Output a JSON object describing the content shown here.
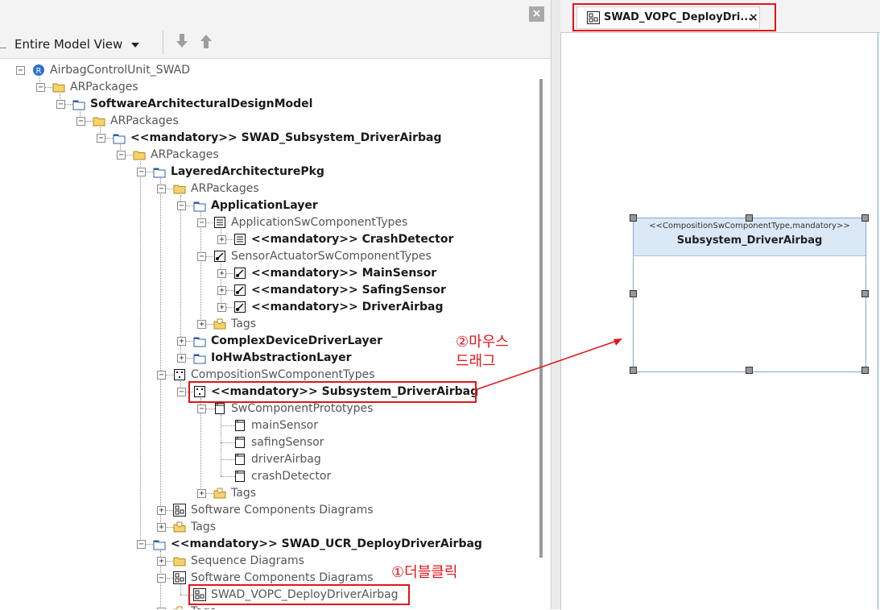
{
  "explorer": {
    "close_label": "×",
    "view_select": {
      "value": "Entire Model View"
    },
    "move_down_tooltip_icon": "arrow-down-icon",
    "move_up_tooltip_icon": "arrow-up-icon",
    "tree": [
      {
        "label": "AirbagControlUnit_SWAD",
        "icon": "model-icon",
        "bold": false,
        "indent": 0
      },
      {
        "label": "ARPackages",
        "icon": "folder-icon",
        "bold": false,
        "indent": 1
      },
      {
        "label": "SoftwareArchitecturalDesignModel",
        "icon": "package-icon",
        "bold": true,
        "indent": 2
      },
      {
        "label": "ARPackages",
        "icon": "folder-icon",
        "bold": false,
        "indent": 3
      },
      {
        "label": "<<mandatory>> SWAD_Subsystem_DriverAirbag",
        "icon": "package-icon",
        "bold": true,
        "indent": 4
      },
      {
        "label": "ARPackages",
        "icon": "folder-icon",
        "bold": false,
        "indent": 5
      },
      {
        "label": "LayeredArchitecturePkg",
        "icon": "package-icon",
        "bold": true,
        "indent": 6
      },
      {
        "label": "ARPackages",
        "icon": "folder-icon",
        "bold": false,
        "indent": 7
      },
      {
        "label": "ApplicationLayer",
        "icon": "package-icon",
        "bold": true,
        "indent": 8
      },
      {
        "label": "ApplicationSwComponentTypes",
        "icon": "application-component-icon",
        "bold": false,
        "indent": 9
      },
      {
        "label": "<<mandatory>> CrashDetector",
        "icon": "application-component-icon",
        "bold": true,
        "indent": 10
      },
      {
        "label": "SensorActuatorSwComponentTypes",
        "icon": "sensor-actuator-icon",
        "bold": false,
        "indent": 9
      },
      {
        "label": "<<mandatory>> MainSensor",
        "icon": "sensor-actuator-icon",
        "bold": true,
        "indent": 10
      },
      {
        "label": "<<mandatory>> SafingSensor",
        "icon": "sensor-actuator-icon",
        "bold": true,
        "indent": 10
      },
      {
        "label": "<<mandatory>> DriverAirbag",
        "icon": "sensor-actuator-icon",
        "bold": true,
        "indent": 10
      },
      {
        "label": "Tags",
        "icon": "tag-folder-icon",
        "bold": false,
        "indent": 9
      },
      {
        "label": "ComplexDeviceDriverLayer",
        "icon": "package-icon",
        "bold": true,
        "indent": 8
      },
      {
        "label": "IoHwAbstractionLayer",
        "icon": "package-icon",
        "bold": true,
        "indent": 8
      },
      {
        "label": "CompositionSwComponentTypes",
        "icon": "composition-icon",
        "bold": false,
        "indent": 7
      },
      {
        "label": "<<mandatory>> Subsystem_DriverAirbag",
        "icon": "composition-icon",
        "bold": true,
        "indent": 8
      },
      {
        "label": "SwComponentPrototypes",
        "icon": "prototype-icon",
        "bold": false,
        "indent": 9
      },
      {
        "label": "mainSensor",
        "icon": "prototype-icon",
        "bold": false,
        "indent": 10
      },
      {
        "label": "safingSensor",
        "icon": "prototype-icon",
        "bold": false,
        "indent": 10
      },
      {
        "label": "driverAirbag",
        "icon": "prototype-icon",
        "bold": false,
        "indent": 10
      },
      {
        "label": "crashDetector",
        "icon": "prototype-icon",
        "bold": false,
        "indent": 10
      },
      {
        "label": "Tags",
        "icon": "tag-folder-icon",
        "bold": false,
        "indent": 9
      },
      {
        "label": "Software Components Diagrams",
        "icon": "diagram-icon",
        "bold": false,
        "indent": 7
      },
      {
        "label": "Tags",
        "icon": "tag-folder-icon",
        "bold": false,
        "indent": 7
      },
      {
        "label": "<<mandatory>> SWAD_UCR_DeployDriverAirbag",
        "icon": "package-icon",
        "bold": true,
        "indent": 6
      },
      {
        "label": "Sequence Diagrams",
        "icon": "folder-icon",
        "bold": false,
        "indent": 7
      },
      {
        "label": "Software Components Diagrams",
        "icon": "diagram-icon",
        "bold": false,
        "indent": 7
      },
      {
        "label": "SWAD_VOPC_DeployDriverAirbag",
        "icon": "diagram-icon",
        "bold": false,
        "indent": 8
      },
      {
        "label": "Tags",
        "icon": "tag-folder-icon",
        "bold": false,
        "indent": 7
      }
    ]
  },
  "editor": {
    "tab_label": "SWAD_VOPC_DeployDri...",
    "tab_close": "×",
    "component": {
      "stereotype": "<<CompositionSwComponentType,mandatory>>",
      "name": "Subsystem_DriverAirbag"
    }
  },
  "annotations": {
    "drag_line1": "②마우스",
    "drag_line2": "드래그",
    "doubleclick": "①더블클릭"
  },
  "colors": {
    "highlight": "#e0151b",
    "component_header": "#dbe8f6",
    "component_border": "#7fa7d6"
  }
}
